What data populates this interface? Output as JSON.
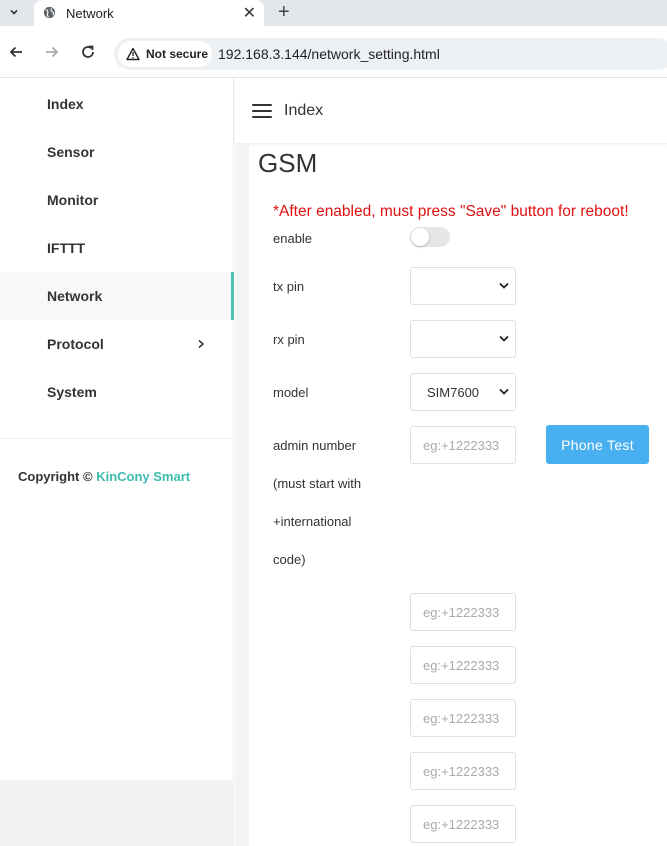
{
  "browser": {
    "tab_title": "Network",
    "security_label": "Not secure",
    "url": "192.168.3.144/network_setting.html"
  },
  "sidebar": {
    "items": [
      {
        "label": "Index"
      },
      {
        "label": "Sensor"
      },
      {
        "label": "Monitor"
      },
      {
        "label": "IFTTT"
      },
      {
        "label": "Network",
        "active": true
      },
      {
        "label": "Protocol"
      },
      {
        "label": "System"
      }
    ],
    "copyright_prefix": "Copyright ©",
    "copyright_brand": "KinCony Smart"
  },
  "header": {
    "title": "Index"
  },
  "main": {
    "section_title": "GSM",
    "warning": "*After enabled, must press \"Save\" button for reboot!",
    "enable_label": "enable",
    "tx_pin_label": "tx pin",
    "rx_pin_label": "rx pin",
    "model_label": "model",
    "model_value": "SIM7600",
    "admin_label_lines": [
      "admin number",
      "(must start with",
      "+international",
      "code)"
    ],
    "phone_placeholder": "eg:+1222333",
    "phone_test_label": "Phone Test"
  },
  "colors": {
    "accent": "#4ec2b4",
    "primary_button": "#48aff0",
    "warning": "#e01010"
  }
}
